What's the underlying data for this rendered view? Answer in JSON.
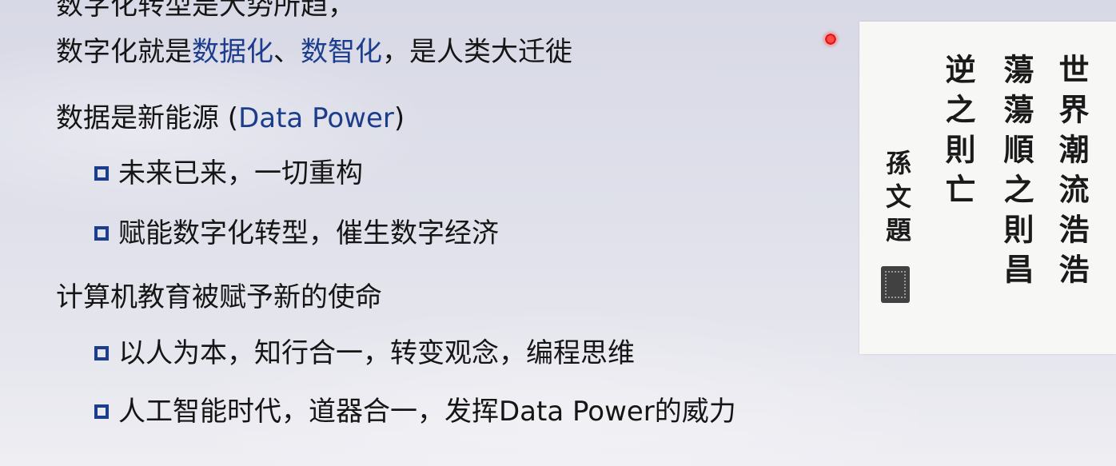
{
  "slide": {
    "line0": "数字化转型是大势所趋，",
    "line1_prefix": "数字化就是",
    "line1_hl1": "数据化",
    "line1_sep": "、",
    "line1_hl2": "数智化",
    "line1_suffix": "，是人类大迁徙",
    "line2_prefix": "数据是新能源 (",
    "line2_en": "Data Power",
    "line2_suffix": ")",
    "bullet1": "未来已来，一切重构",
    "bullet2": "赋能数字化转型，催生数字经济",
    "line3": "计算机教育被赋予新的使命",
    "bullet3": "以人为本，知行合一，转变观念，编程思维",
    "bullet4": "人工智能时代，道器合一，发挥Data Power的威力"
  },
  "calligraphy": {
    "col1": "世界潮流浩浩",
    "col2": "蕩蕩順之則昌",
    "col3": "逆之則亡",
    "signature": "孫文題"
  },
  "colors": {
    "text": "#151515",
    "accent_blue": "#1c3d8c",
    "laser_red": "#e01818"
  }
}
